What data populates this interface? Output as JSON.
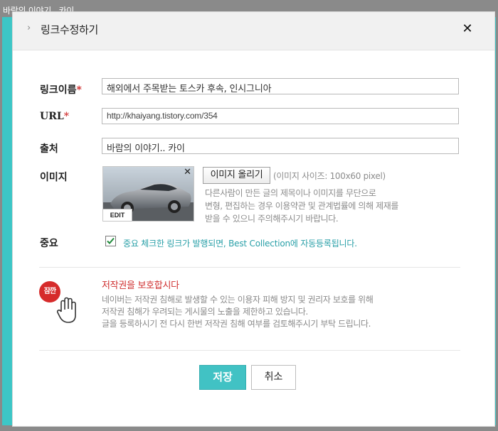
{
  "window": {
    "title": "바람의 이야기.. 카이"
  },
  "dialog": {
    "title": "링크수정하기",
    "close_label": "✕"
  },
  "form": {
    "link_name": {
      "label": "링크이름",
      "required_mark": "*",
      "value": "해외에서 주목받는 토스카 후속, 인시그니아"
    },
    "url": {
      "label": "URL",
      "required_mark": "*",
      "value": "http://khaiyang.tistory.com/354"
    },
    "source": {
      "label": "출처",
      "value": "바람의 이야기.. 카이"
    },
    "image": {
      "label": "이미지",
      "thumb_close": "✕",
      "edit_label": "EDIT",
      "upload_label": "이미지 올리기",
      "size_hint": "(이미지 사이즈: 100x60 pixel)",
      "warning_lines": [
        "다른사람이 만든 글의 제목이나 이미지를 무단으로",
        "변형, 편집하는 경우 이용약관 및 관계법률에 의해 제재를",
        "받을 수 있으니 주의해주시기 바랍니다."
      ]
    },
    "important": {
      "label": "중요",
      "checked": true,
      "text": "중요 체크한 링크가 발행되면, Best Collection에 자동등록됩니다."
    }
  },
  "copyright": {
    "badge": "잠깐",
    "title": "저작권을 보호합시다",
    "lines": [
      "네이버는 저작권 침해로 발생할 수 있는 이용자 피해 방지 및 권리자 보호를 위해",
      "저작권 침해가 우려되는 게시물의 노출을 제한하고 있습니다.",
      "글을 등록하시기 전 다시 한번 저작권 침해 여부를 검토해주시기 부탁 드립니다."
    ]
  },
  "buttons": {
    "save": "저장",
    "cancel": "취소"
  },
  "colors": {
    "accent": "#41c2c4",
    "frame": "#3dc6c6",
    "required": "#d23a3a",
    "badge": "#d62b2b"
  }
}
